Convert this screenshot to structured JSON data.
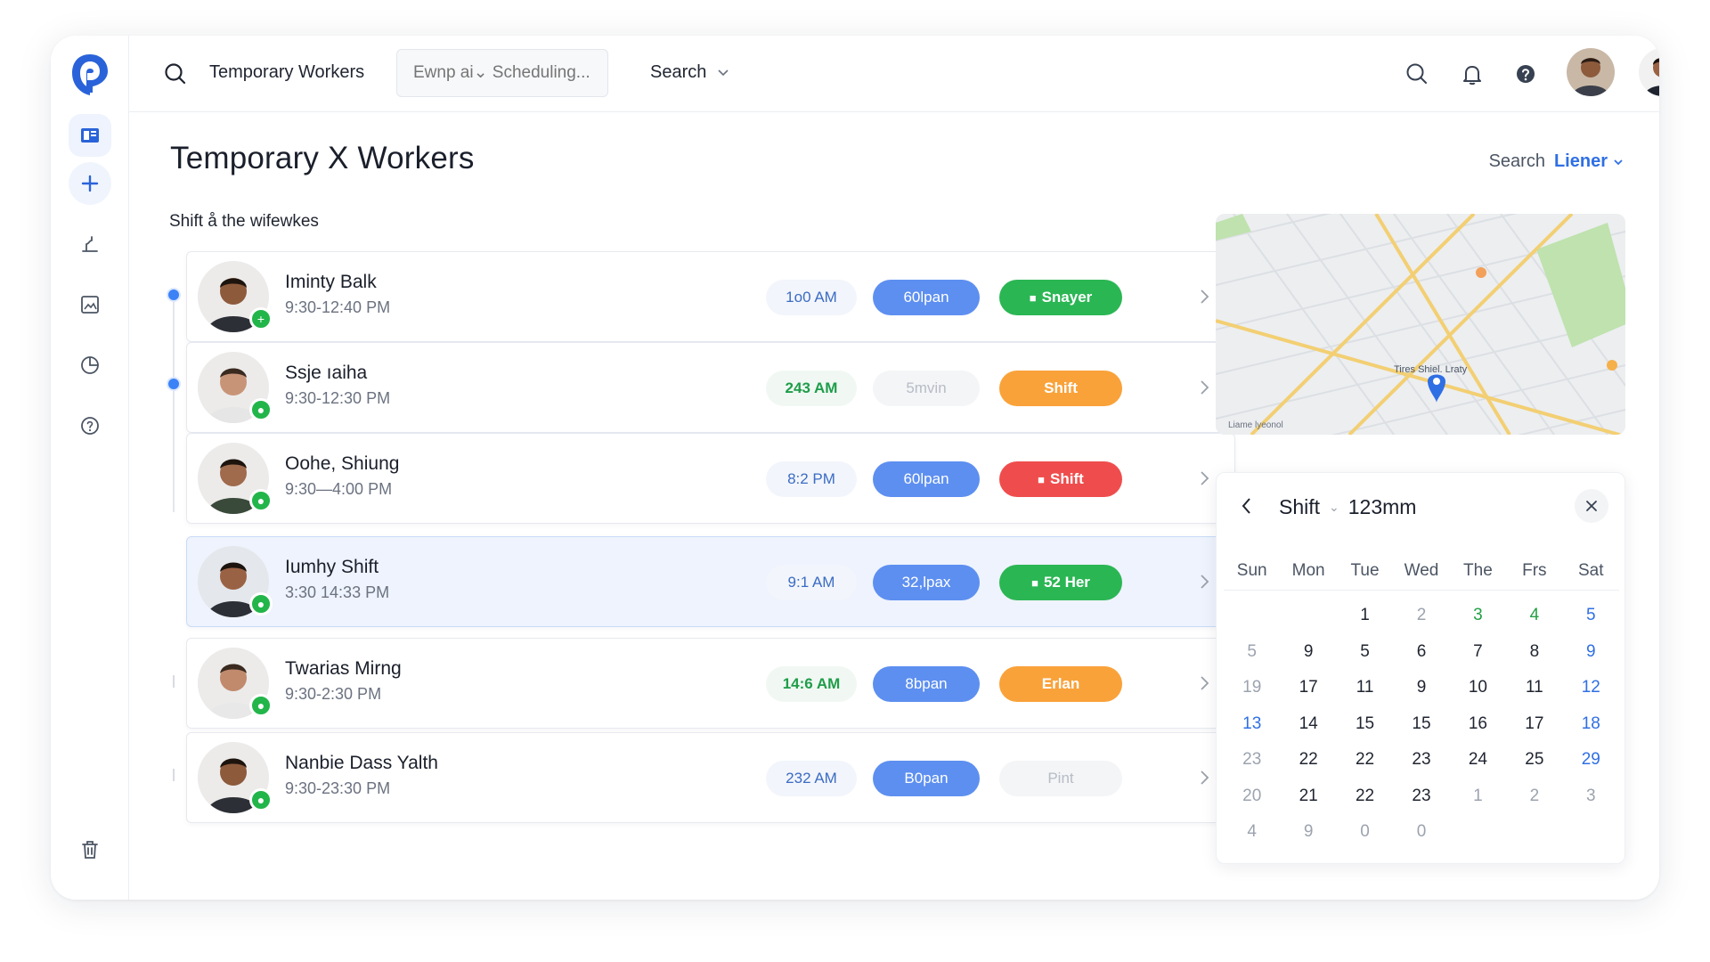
{
  "topbar": {
    "title": "Temporary Workers",
    "input_placeholder": "Ewnp ai⌄ Scheduling...",
    "search_label": "Search"
  },
  "page": {
    "title": "Temporary X Workers",
    "subtitle": "Shift å the wifewkes",
    "right_search_label": "Search",
    "right_search_value": "Liener"
  },
  "workers": [
    {
      "name": "Iminty Balk",
      "time": "9:30-12:40 PM",
      "tag1": "1o0 AM",
      "tag2": "60lpan",
      "tag3": "Snayer",
      "status_icon": "+"
    },
    {
      "name": "Ssje ıaiha",
      "time": "9:30-12:30 PM",
      "tag1": "243 AM",
      "tag2": "5mvin",
      "tag3": "Shift",
      "status_icon": "●"
    },
    {
      "name": "Oohe, Shiung",
      "time": "9:30—4:00 PM",
      "tag1": "8:2 PM",
      "tag2": "60lpan",
      "tag3": "Shift",
      "status_icon": "●"
    },
    {
      "name": "Iumhy Shift",
      "time": "3:30 14:33 PM",
      "tag1": "9:1 AM",
      "tag2": "32,lpax",
      "tag3": "52 Her",
      "status_icon": "●"
    },
    {
      "name": "Twarias Mirng",
      "time": "9:30-2:30 PM",
      "tag1": "14:6 AM",
      "tag2": "8bpan",
      "tag3": "Erlan",
      "status_icon": "●"
    },
    {
      "name": "Nanbie Dass Yalth",
      "time": "9:30-23:30 PM",
      "tag1": "232 AM",
      "tag2": "B0pan",
      "tag3": "Pint",
      "status_icon": "●"
    }
  ],
  "map": {
    "place_label": "Tires Shiel. Lraty",
    "corner_label": "Liame lyeonol"
  },
  "calendar": {
    "label": "Shift",
    "value": "123mm",
    "weekdays": [
      "Sun",
      "Mon",
      "Tue",
      "Wed",
      "The",
      "Frs",
      "Sat"
    ],
    "weeks": [
      [
        "",
        "",
        "1",
        "2",
        "3",
        "4",
        "5"
      ],
      [
        "5",
        "9",
        "5",
        "6",
        "7",
        "8",
        "9"
      ],
      [
        "19",
        "17",
        "11",
        "9",
        "10",
        "11",
        "12"
      ],
      [
        "13",
        "14",
        "15",
        "15",
        "16",
        "17",
        "18"
      ],
      [
        "23",
        "22",
        "22",
        "23",
        "24",
        "25",
        "29"
      ],
      [
        "20",
        "21",
        "22",
        "23",
        "1",
        "2",
        "3"
      ],
      [
        "4",
        "9",
        "0",
        "0",
        "",
        "",
        ""
      ]
    ]
  },
  "colors": {
    "accent": "#2f6fe4",
    "pill_blue": "#5d8ff0",
    "green": "#2bb654",
    "orange": "#f9a23a",
    "red": "#ef4d4d"
  }
}
